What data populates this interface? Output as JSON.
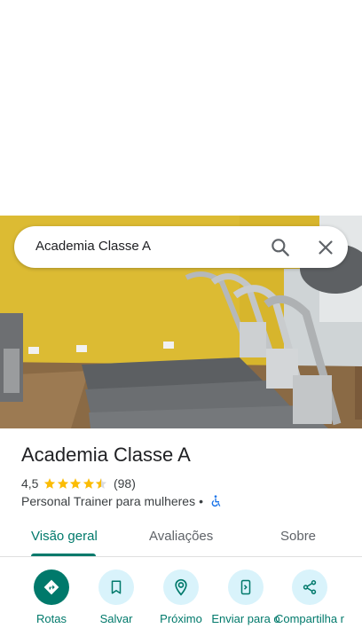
{
  "search": {
    "query": "Academia Classe A"
  },
  "place": {
    "title": "Academia Classe A",
    "rating": "4,5",
    "rating_fraction": 0.9,
    "review_count": "(98)",
    "category": "Personal Trainer para mulheres",
    "separator": "•"
  },
  "tabs": [
    {
      "label": "Visão geral",
      "active": true
    },
    {
      "label": "Avaliações",
      "active": false
    },
    {
      "label": "Sobre",
      "active": false
    }
  ],
  "actions": [
    {
      "label": "Rotas",
      "icon": "directions-icon"
    },
    {
      "label": "Salvar",
      "icon": "bookmark-icon"
    },
    {
      "label": "Próximo",
      "icon": "nearby-icon"
    },
    {
      "label": "Enviar para o",
      "icon": "send-to-phone-icon"
    },
    {
      "label": "Compartilha r",
      "icon": "share-icon"
    }
  ],
  "colors": {
    "accent": "#00796b",
    "action_bg": "#d9f3fb",
    "star": "#fbbc04"
  }
}
